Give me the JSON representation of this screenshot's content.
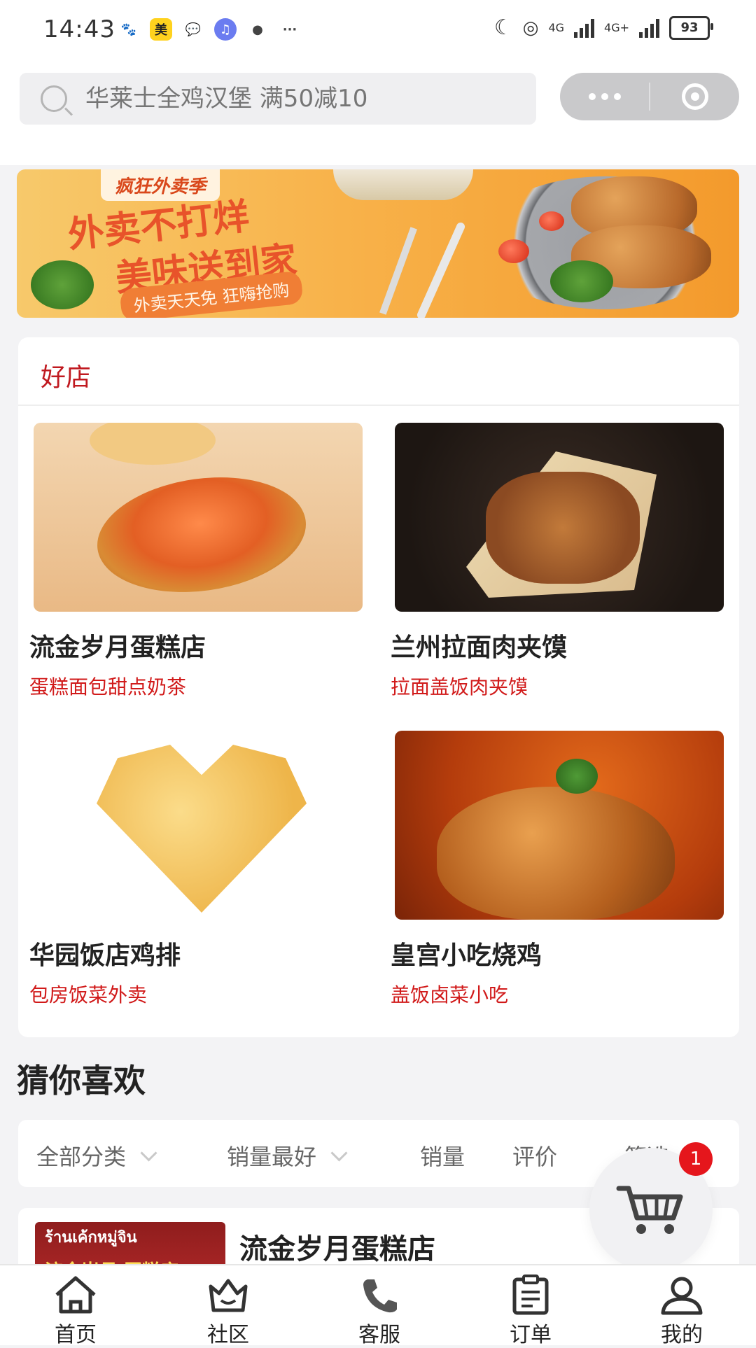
{
  "status_bar": {
    "time": "14:43",
    "battery": "93",
    "net1": "4G",
    "net2": "4G+"
  },
  "search": {
    "placeholder": "华莱士全鸡汉堡 满50减10"
  },
  "banner": {
    "tag": "疯狂外卖季",
    "line1": "外卖不打烊",
    "line2": "美味送到家",
    "pill": "外卖天天免 狂嗨抢购"
  },
  "good_shops": {
    "title": "好店",
    "items": [
      {
        "name": "流金岁月蛋糕店",
        "tags": "蛋糕面包甜点奶茶"
      },
      {
        "name": "兰州拉面肉夹馍",
        "tags": "拉面盖饭肉夹馍"
      },
      {
        "name": "华园饭店鸡排",
        "tags": "包房饭菜外卖"
      },
      {
        "name": "皇宫小吃烧鸡",
        "tags": "盖饭卤菜小吃"
      }
    ]
  },
  "guess": {
    "title": "猜你喜欢",
    "filters": [
      "全部分类",
      "销量最好",
      "销量",
      "评价",
      "筛选"
    ]
  },
  "list": {
    "first_shop": "流金岁月蛋糕店",
    "first_shop_sign_thai": "ร้านเค้กหมู่จิน",
    "first_shop_sign_cn": "流金岁月 蛋糕店"
  },
  "cart": {
    "badge": "1"
  },
  "tabs": [
    "首页",
    "社区",
    "客服",
    "订单",
    "我的"
  ]
}
